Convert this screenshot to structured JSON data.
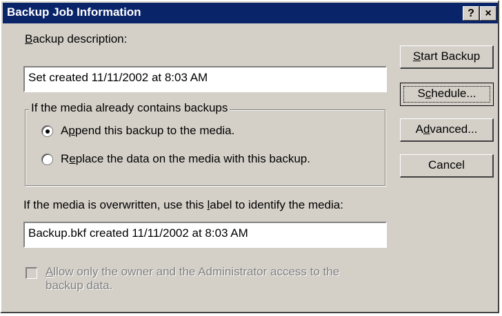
{
  "window": {
    "title": "Backup Job Information",
    "help_glyph": "?",
    "close_glyph": "×"
  },
  "description": {
    "label_hotkey": "B",
    "label_rest": "ackup description:",
    "value": "Set created 11/11/2002 at 8:03 AM"
  },
  "media_group": {
    "title": "If the media already contains backups",
    "append": {
      "pre": "A",
      "hotkey": "p",
      "post": "pend this backup to the media.",
      "selected": true
    },
    "replace": {
      "pre": "R",
      "hotkey": "e",
      "post": "place the data on the media with this backup.",
      "selected": false
    }
  },
  "label": {
    "prompt_pre": "If the media is overwritten, use this ",
    "prompt_hotkey": "l",
    "prompt_post": "abel to identify the media:",
    "value": "Backup.bkf created 11/11/2002 at 8:03 AM"
  },
  "access": {
    "hotkey": "A",
    "line1_rest": "llow only the owner and the Administrator access to the",
    "line2": "backup data.",
    "checked": false,
    "enabled": false
  },
  "buttons": {
    "start": {
      "hotkey": "S",
      "rest": "tart Backup"
    },
    "schedule": {
      "pre": "S",
      "hotkey": "c",
      "post": "hedule..."
    },
    "advanced": {
      "pre": "A",
      "hotkey": "d",
      "post": "vanced..."
    },
    "cancel": {
      "label": "Cancel"
    }
  }
}
